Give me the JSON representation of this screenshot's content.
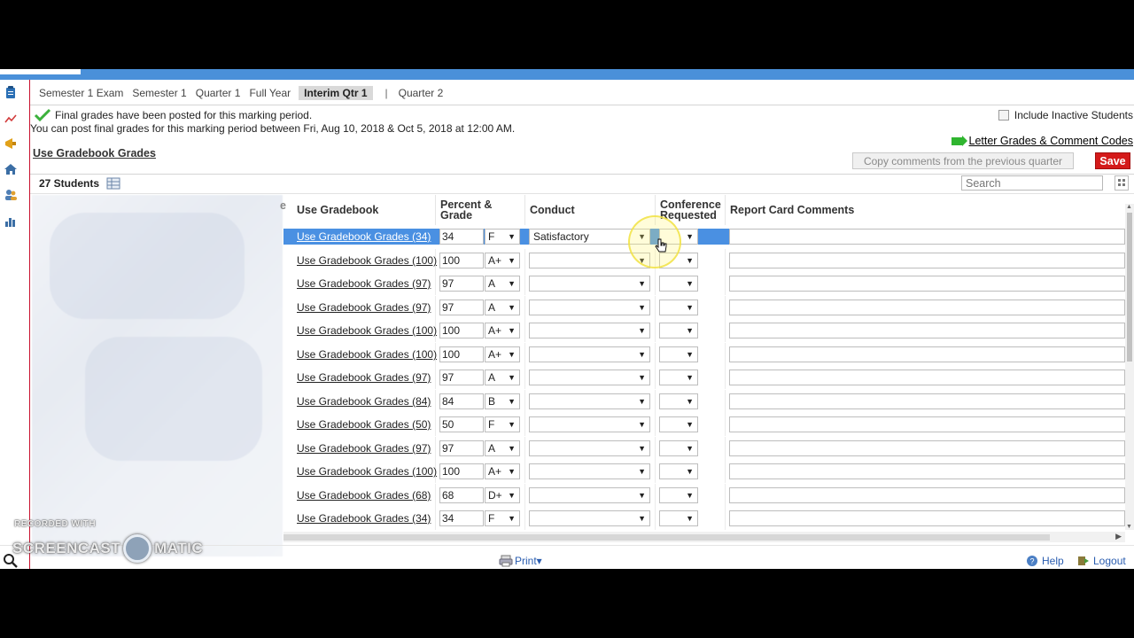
{
  "tabs": [
    {
      "label": "Semester 1 Exam",
      "active": false
    },
    {
      "label": "Semester 1",
      "active": false
    },
    {
      "label": "Quarter 1",
      "active": false
    },
    {
      "label": "Full Year",
      "active": false
    },
    {
      "label": "Interim Qtr 1",
      "active": true
    },
    {
      "label": "Quarter 2",
      "active": false
    }
  ],
  "tab_separator": "|",
  "notice": {
    "line1": "Final grades have been posted for this marking period.",
    "line2": "You can post final grades for this marking period between Fri, Aug 10, 2018 & Oct 5, 2018 at 12:00 AM."
  },
  "include_inactive_label": "Include Inactive Students",
  "letter_grades_link": "Letter Grades & Comment Codes",
  "use_gradebook_grades_link": "Use Gradebook Grades",
  "copy_comments_button": "Copy comments from the previous quarter",
  "save_button": "Save",
  "students_count": "27 Students",
  "search_placeholder": "Search",
  "columns": {
    "use_gradebook": "Use Gradebook",
    "percent_grade_1": "Percent &",
    "percent_grade_2": "Grade",
    "conduct": "Conduct",
    "conference_1": "Conference",
    "conference_2": "Requested",
    "report_card_comments": "Report Card Comments",
    "cut_header": "e"
  },
  "rows": [
    {
      "link": "Use Gradebook Grades (34)",
      "percent": "34",
      "grade": "F",
      "conduct": "Satisfactory",
      "selected": true
    },
    {
      "link": "Use Gradebook Grades (100)",
      "percent": "100",
      "grade": "A+",
      "conduct": "",
      "selected": false
    },
    {
      "link": "Use Gradebook Grades (97)",
      "percent": "97",
      "grade": "A",
      "conduct": "",
      "selected": false
    },
    {
      "link": "Use Gradebook Grades (97)",
      "percent": "97",
      "grade": "A",
      "conduct": "",
      "selected": false
    },
    {
      "link": "Use Gradebook Grades (100)",
      "percent": "100",
      "grade": "A+",
      "conduct": "",
      "selected": false
    },
    {
      "link": "Use Gradebook Grades (100)",
      "percent": "100",
      "grade": "A+",
      "conduct": "",
      "selected": false
    },
    {
      "link": "Use Gradebook Grades (97)",
      "percent": "97",
      "grade": "A",
      "conduct": "",
      "selected": false
    },
    {
      "link": "Use Gradebook Grades (84)",
      "percent": "84",
      "grade": "B",
      "conduct": "",
      "selected": false
    },
    {
      "link": "Use Gradebook Grades (50)",
      "percent": "50",
      "grade": "F",
      "conduct": "",
      "selected": false
    },
    {
      "link": "Use Gradebook Grades (97)",
      "percent": "97",
      "grade": "A",
      "conduct": "",
      "selected": false
    },
    {
      "link": "Use Gradebook Grades (100)",
      "percent": "100",
      "grade": "A+",
      "conduct": "",
      "selected": false
    },
    {
      "link": "Use Gradebook Grades (68)",
      "percent": "68",
      "grade": "D+",
      "conduct": "",
      "selected": false
    },
    {
      "link": "Use Gradebook Grades (34)",
      "percent": "34",
      "grade": "F",
      "conduct": "",
      "selected": false
    }
  ],
  "footer": {
    "print": "Print▾",
    "help": "Help",
    "logout": "Logout"
  },
  "watermark": {
    "recorded_with": "RECORDED WITH",
    "brand_left": "SCREENCAST",
    "brand_right": "MATIC"
  },
  "colors": {
    "accent_blue": "#4a90e2",
    "save_red": "#d41a1a",
    "link_blue": "#2a5db0"
  }
}
